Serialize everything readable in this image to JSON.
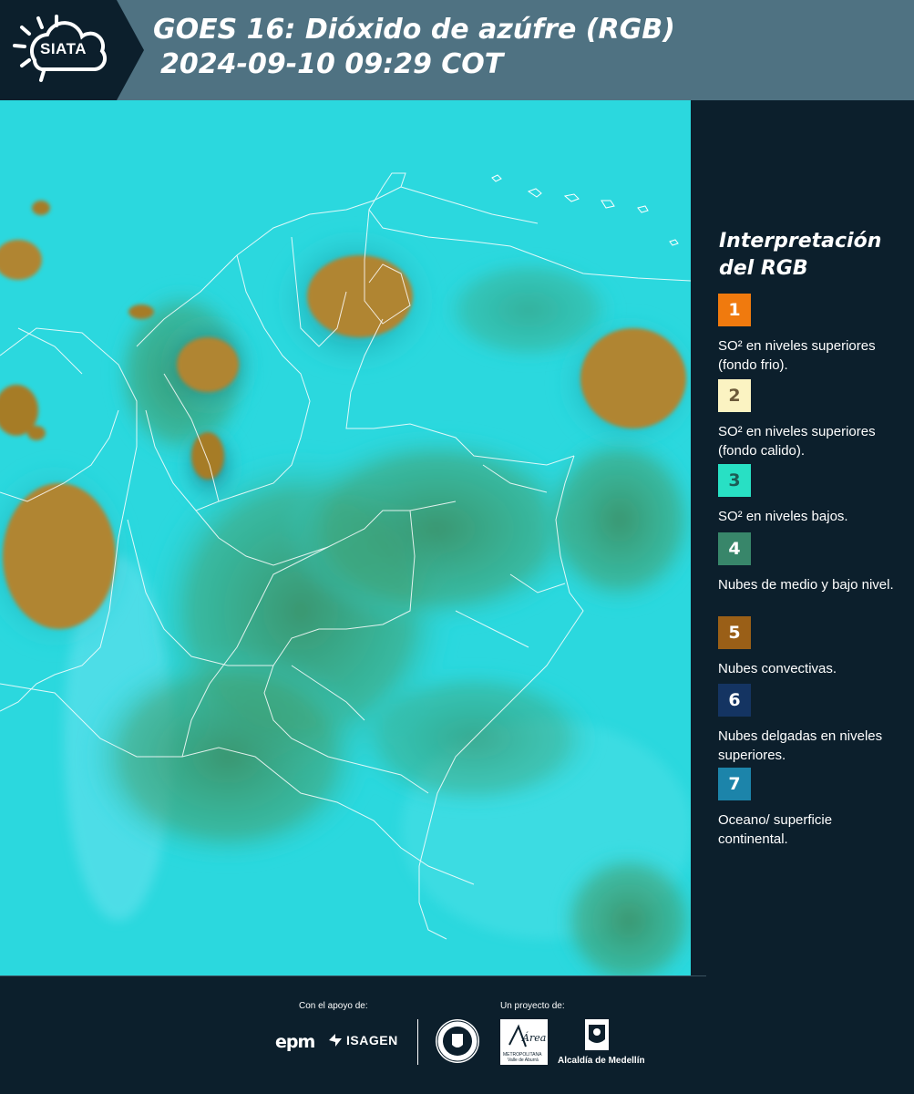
{
  "header": {
    "logo_text": "SIATA",
    "title_line1": "GOES 16: Dióxido de azúfre (RGB)",
    "title_line2": "2024-09-10 09:29 COT"
  },
  "legend": {
    "title_line1": "Interpretación",
    "title_line2": "del RGB",
    "items": [
      {
        "number": "1",
        "color": "#f07a0e",
        "text_color": "#ffffff",
        "label": "SO² en niveles superiores (fondo frio)."
      },
      {
        "number": "2",
        "color": "#fbf3c2",
        "text_color": "#6b5a3a",
        "label": "SO² en niveles superiores (fondo calido)."
      },
      {
        "number": "3",
        "color": "#28e0c4",
        "text_color": "#1c5c55",
        "label": "SO² en niveles bajos."
      },
      {
        "number": "4",
        "color": "#38866a",
        "text_color": "#ffffff",
        "label": "Nubes de medio y bajo nivel."
      },
      {
        "number": "5",
        "color": "#9a5f17",
        "text_color": "#ffffff",
        "label": "Nubes convectivas."
      },
      {
        "number": "6",
        "color": "#143462",
        "text_color": "#ffffff",
        "label": "Nubes delgadas en niveles superiores."
      },
      {
        "number": "7",
        "color": "#1c84aa",
        "text_color": "#ffffff",
        "label": "Oceano/ superficie continental."
      }
    ]
  },
  "map": {
    "background_color": "#2ad6dc",
    "convective_color": "#b0832a",
    "lowcloud_color": "#3f9468",
    "border_color": "#ffffff"
  },
  "footer": {
    "support_label": "Con el apoyo de:",
    "project_label": "Un proyecto de:",
    "sponsor1": "epm",
    "sponsor2": "ISAGEN",
    "area_logo_text": "Área",
    "area_sub1": "METROPOLITANA",
    "area_sub2": "Valle de Aburrá",
    "alcaldia": "Alcaldía de Medellín"
  }
}
